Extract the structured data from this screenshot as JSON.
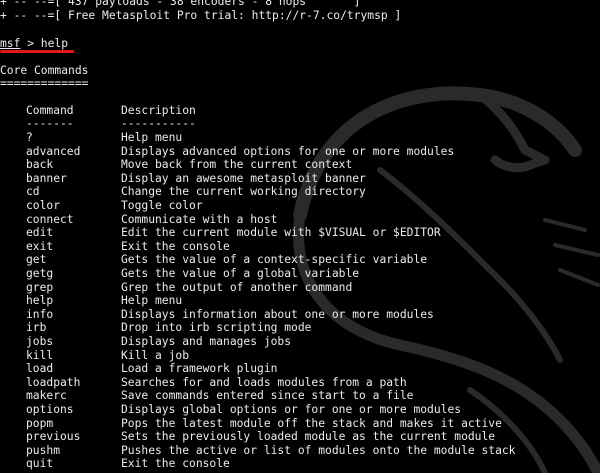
{
  "banner": {
    "payloads_line": "+ -- --=[ 437 payloads - 38 encoders - 8 nops       ]",
    "trial_line": "+ -- --=[ Free Metasploit Pro trial: http://r-7.co/trymsp ]"
  },
  "prompt": {
    "name": "msf",
    "rest": " > help"
  },
  "section": {
    "title": "Core Commands",
    "underline": "============="
  },
  "table": {
    "header_command": "Command",
    "header_description": "Description",
    "sep_command": "-------",
    "sep_description": "-----------"
  },
  "commands": [
    {
      "name": "?",
      "desc": "Help menu"
    },
    {
      "name": "advanced",
      "desc": "Displays advanced options for one or more modules"
    },
    {
      "name": "back",
      "desc": "Move back from the current context"
    },
    {
      "name": "banner",
      "desc": "Display an awesome metasploit banner"
    },
    {
      "name": "cd",
      "desc": "Change the current working directory"
    },
    {
      "name": "color",
      "desc": "Toggle color"
    },
    {
      "name": "connect",
      "desc": "Communicate with a host"
    },
    {
      "name": "edit",
      "desc": "Edit the current module with $VISUAL or $EDITOR"
    },
    {
      "name": "exit",
      "desc": "Exit the console"
    },
    {
      "name": "get",
      "desc": "Gets the value of a context-specific variable"
    },
    {
      "name": "getg",
      "desc": "Gets the value of a global variable"
    },
    {
      "name": "grep",
      "desc": "Grep the output of another command"
    },
    {
      "name": "help",
      "desc": "Help menu"
    },
    {
      "name": "info",
      "desc": "Displays information about one or more modules"
    },
    {
      "name": "irb",
      "desc": "Drop into irb scripting mode"
    },
    {
      "name": "jobs",
      "desc": "Displays and manages jobs"
    },
    {
      "name": "kill",
      "desc": "Kill a job"
    },
    {
      "name": "load",
      "desc": "Load a framework plugin"
    },
    {
      "name": "loadpath",
      "desc": "Searches for and loads modules from a path"
    },
    {
      "name": "makerc",
      "desc": "Save commands entered since start to a file"
    },
    {
      "name": "options",
      "desc": "Displays global options or for one or more modules"
    },
    {
      "name": "popm",
      "desc": "Pops the latest module off the stack and makes it active"
    },
    {
      "name": "previous",
      "desc": "Sets the previously loaded module as the current module"
    },
    {
      "name": "pushm",
      "desc": "Pushes the active or list of modules onto the module stack"
    },
    {
      "name": "quit",
      "desc": "Exit the console"
    }
  ],
  "colors": {
    "background": "#000000",
    "text": "#ececec",
    "highlight_underline": "#e01818",
    "dragon": "#2a2a2a"
  },
  "icons": {
    "background_logo": "kali-dragon-icon"
  }
}
